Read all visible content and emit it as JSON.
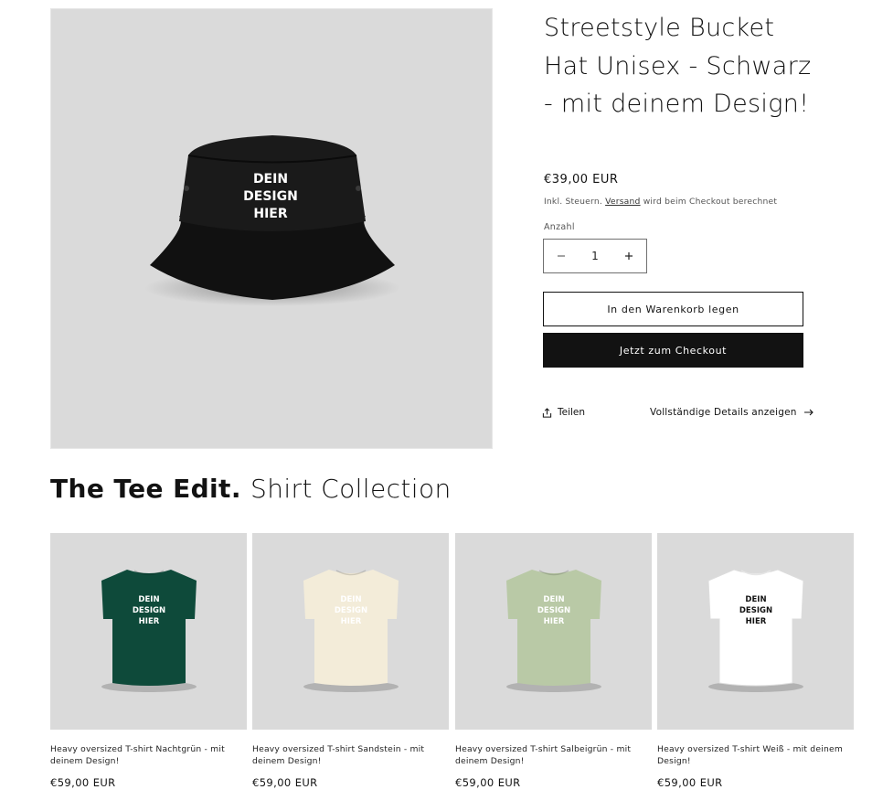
{
  "product": {
    "title": "Streetstyle Bucket Hat Unisex - Schwarz - mit deinem Design!",
    "image_text": [
      "DEIN",
      "DESIGN",
      "HIER"
    ],
    "price": "€39,00 EUR",
    "tax_prefix": "Inkl. Steuern.",
    "tax_link": "Versand",
    "tax_suffix": "wird beim Checkout berechnet",
    "quantity_label": "Anzahl",
    "quantity_value": "1",
    "decrease_symbol": "−",
    "increase_symbol": "+",
    "add_to_cart_label": "In den Warenkorb legen",
    "checkout_label": "Jetzt zum Checkout",
    "share_label": "Teilen",
    "details_label": "Vollständige Details anzeigen"
  },
  "collection": {
    "title_bold": "The Tee Edit.",
    "title_light": "Shirt Collection",
    "items": [
      {
        "name": "Heavy oversized T-shirt Nachtgrün - mit deinem Design!",
        "price": "€59,00 EUR",
        "shirt_color": "#0e4a3a",
        "text_color": "#ffffff"
      },
      {
        "name": "Heavy oversized T-shirt Sandstein - mit deinem Design!",
        "price": "€59,00 EUR",
        "shirt_color": "#f3ecd9",
        "text_color": "#ffffff"
      },
      {
        "name": "Heavy oversized T-shirt Salbeigrün - mit deinem Design!",
        "price": "€59,00 EUR",
        "shirt_color": "#b9c9a6",
        "text_color": "#ffffff"
      },
      {
        "name": "Heavy oversized T-shirt Weiß - mit deinem Design!",
        "price": "€59,00 EUR",
        "shirt_color": "#ffffff",
        "text_color": "#111111"
      }
    ]
  },
  "colors": {
    "image_bg": "#dadada",
    "hat": "#151515",
    "button_dark": "#121212"
  },
  "icons": [
    "share-icon",
    "arrow-right-icon",
    "minus-icon",
    "plus-icon"
  ]
}
